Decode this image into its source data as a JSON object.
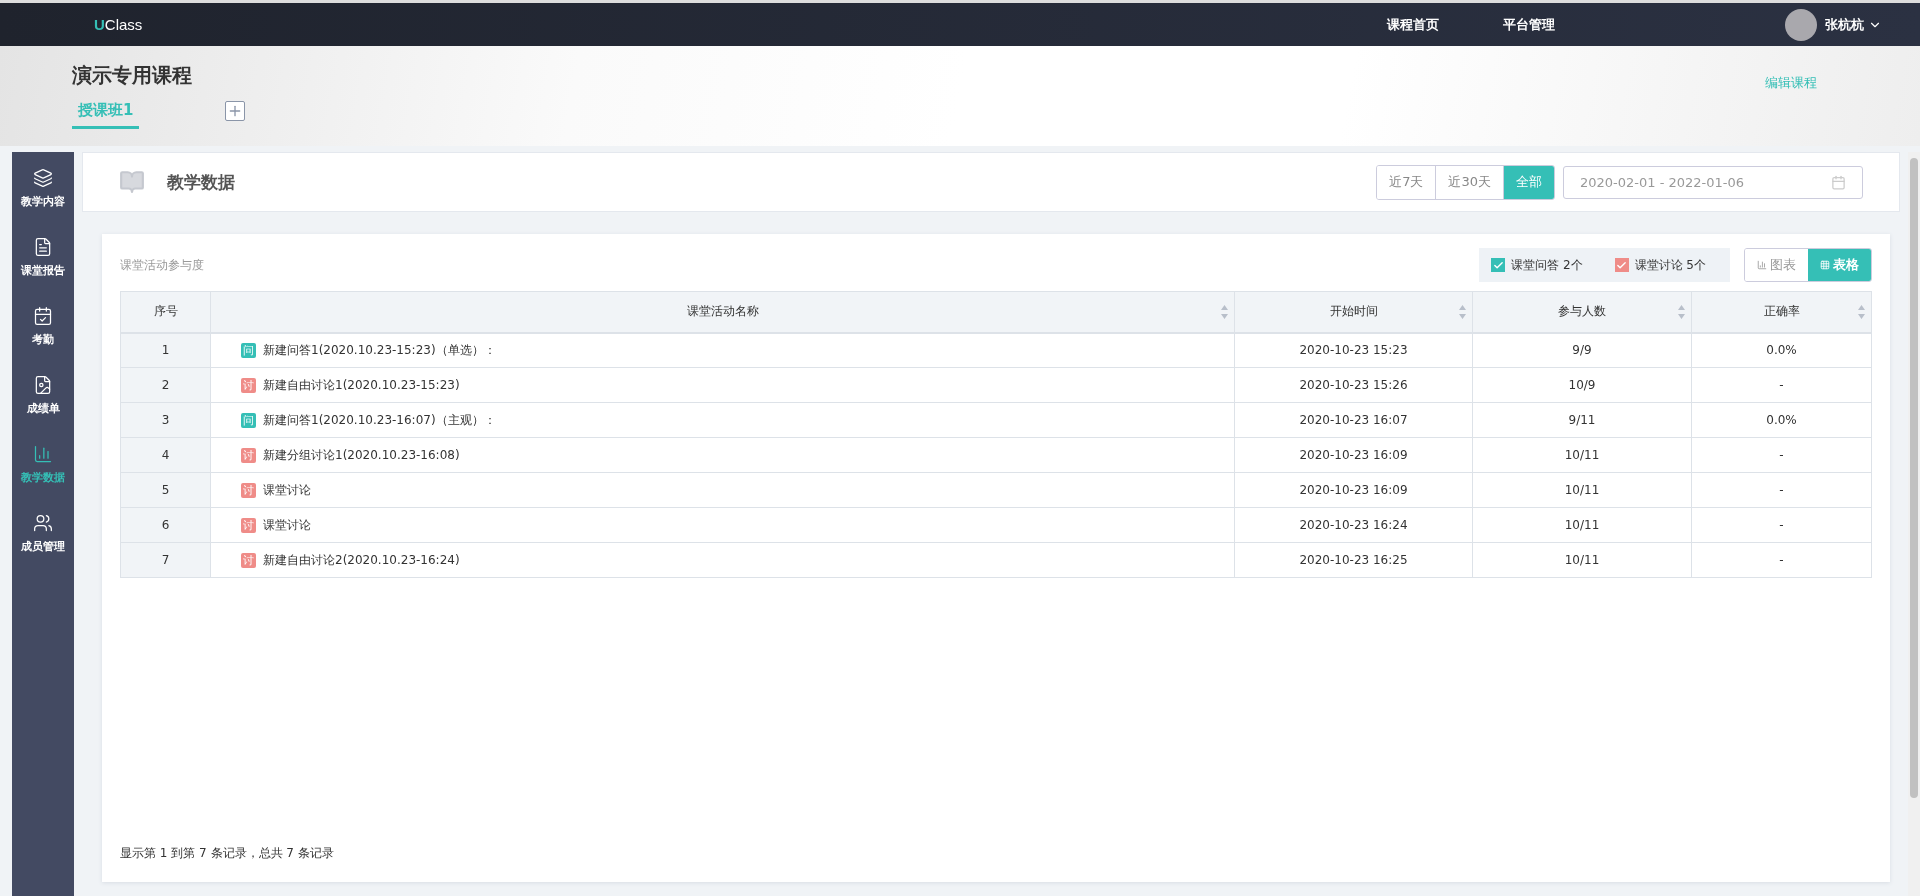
{
  "topbar": {
    "logo": {
      "accent": "U",
      "rest": "Class"
    },
    "nav": [
      {
        "label": "课程首页"
      },
      {
        "label": "平台管理"
      }
    ],
    "user": {
      "name": "张杭杭"
    }
  },
  "course": {
    "title": "演示专用课程",
    "edit_link": "编辑课程",
    "classes": [
      {
        "label": "授课班1",
        "selected": true
      }
    ]
  },
  "sidebar": {
    "items": [
      {
        "label": "教学内容",
        "selected": false
      },
      {
        "label": "课堂报告",
        "selected": false
      },
      {
        "label": "考勤",
        "selected": false
      },
      {
        "label": "成绩单",
        "selected": false
      },
      {
        "label": "教学数据",
        "selected": true
      },
      {
        "label": "成员管理",
        "selected": false
      }
    ]
  },
  "page": {
    "title": "教学数据",
    "ranges": [
      {
        "label": "近7天",
        "selected": false
      },
      {
        "label": "近30天",
        "selected": false
      },
      {
        "label": "全部",
        "selected": true
      }
    ],
    "date_range": "2020-02-01 - 2022-01-06"
  },
  "panel": {
    "title": "课堂活动参与度",
    "filters": [
      {
        "label": "课堂问答 2个",
        "checked": true,
        "color": "#35bfb6"
      },
      {
        "label": "课堂讨论 5个",
        "checked": true,
        "color": "#ef8c88"
      }
    ],
    "views": [
      {
        "label": "图表",
        "selected": false
      },
      {
        "label": "表格",
        "selected": true
      }
    ],
    "table": {
      "columns": [
        {
          "label": "序号",
          "sortable": false
        },
        {
          "label": "课堂活动名称",
          "sortable": true
        },
        {
          "label": "开始时间",
          "sortable": true
        },
        {
          "label": "参与人数",
          "sortable": true
        },
        {
          "label": "正确率",
          "sortable": true
        }
      ],
      "rows": [
        {
          "index": "1",
          "kind": "question",
          "tag": "问",
          "name": "新建问答1(2020.10.23-15:23)（单选）：",
          "start": "2020-10-23 15:23",
          "participants": "9/9",
          "accuracy": "0.0%"
        },
        {
          "index": "2",
          "kind": "discussion",
          "tag": "讨",
          "name": "新建自由讨论1(2020.10.23-15:23)",
          "start": "2020-10-23 15:26",
          "participants": "10/9",
          "accuracy": "-"
        },
        {
          "index": "3",
          "kind": "question",
          "tag": "问",
          "name": "新建问答1(2020.10.23-16:07)（主观）：",
          "start": "2020-10-23 16:07",
          "participants": "9/11",
          "accuracy": "0.0%"
        },
        {
          "index": "4",
          "kind": "discussion",
          "tag": "讨",
          "name": "新建分组讨论1(2020.10.23-16:08)",
          "start": "2020-10-23 16:09",
          "participants": "10/11",
          "accuracy": "-"
        },
        {
          "index": "5",
          "kind": "discussion",
          "tag": "讨",
          "name": "课堂讨论",
          "start": "2020-10-23 16:09",
          "participants": "10/11",
          "accuracy": "-"
        },
        {
          "index": "6",
          "kind": "discussion",
          "tag": "讨",
          "name": "课堂讨论",
          "start": "2020-10-23 16:24",
          "participants": "10/11",
          "accuracy": "-"
        },
        {
          "index": "7",
          "kind": "discussion",
          "tag": "讨",
          "name": "新建自由讨论2(2020.10.23-16:24)",
          "start": "2020-10-23 16:25",
          "participants": "10/11",
          "accuracy": "-"
        }
      ]
    },
    "footer": "显示第 1 到第 7 条记录，总共 7 条记录"
  }
}
